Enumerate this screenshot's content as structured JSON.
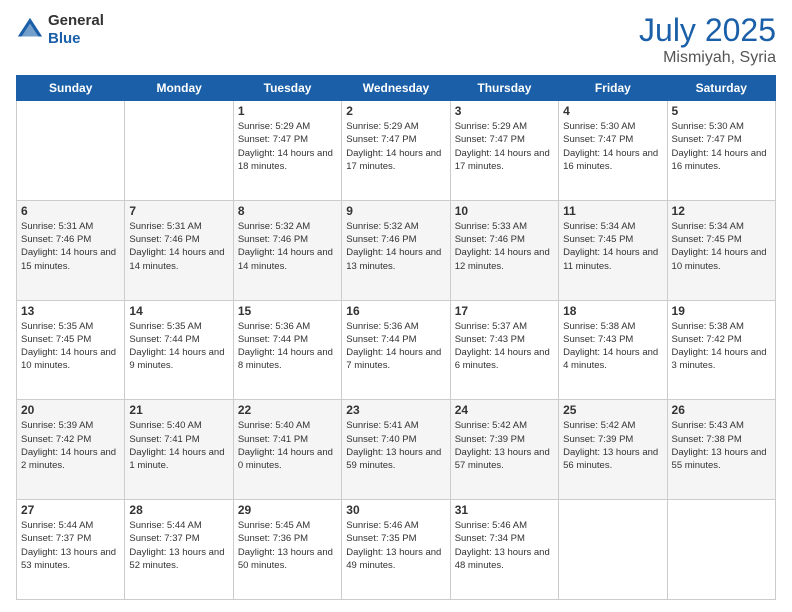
{
  "header": {
    "logo_general": "General",
    "logo_blue": "Blue",
    "title": "July 2025",
    "location": "Mismiyah, Syria"
  },
  "weekdays": [
    "Sunday",
    "Monday",
    "Tuesday",
    "Wednesday",
    "Thursday",
    "Friday",
    "Saturday"
  ],
  "weeks": [
    [
      {
        "day": "",
        "sunrise": "",
        "sunset": "",
        "daylight": ""
      },
      {
        "day": "",
        "sunrise": "",
        "sunset": "",
        "daylight": ""
      },
      {
        "day": "1",
        "sunrise": "Sunrise: 5:29 AM",
        "sunset": "Sunset: 7:47 PM",
        "daylight": "Daylight: 14 hours and 18 minutes."
      },
      {
        "day": "2",
        "sunrise": "Sunrise: 5:29 AM",
        "sunset": "Sunset: 7:47 PM",
        "daylight": "Daylight: 14 hours and 17 minutes."
      },
      {
        "day": "3",
        "sunrise": "Sunrise: 5:29 AM",
        "sunset": "Sunset: 7:47 PM",
        "daylight": "Daylight: 14 hours and 17 minutes."
      },
      {
        "day": "4",
        "sunrise": "Sunrise: 5:30 AM",
        "sunset": "Sunset: 7:47 PM",
        "daylight": "Daylight: 14 hours and 16 minutes."
      },
      {
        "day": "5",
        "sunrise": "Sunrise: 5:30 AM",
        "sunset": "Sunset: 7:47 PM",
        "daylight": "Daylight: 14 hours and 16 minutes."
      }
    ],
    [
      {
        "day": "6",
        "sunrise": "Sunrise: 5:31 AM",
        "sunset": "Sunset: 7:46 PM",
        "daylight": "Daylight: 14 hours and 15 minutes."
      },
      {
        "day": "7",
        "sunrise": "Sunrise: 5:31 AM",
        "sunset": "Sunset: 7:46 PM",
        "daylight": "Daylight: 14 hours and 14 minutes."
      },
      {
        "day": "8",
        "sunrise": "Sunrise: 5:32 AM",
        "sunset": "Sunset: 7:46 PM",
        "daylight": "Daylight: 14 hours and 14 minutes."
      },
      {
        "day": "9",
        "sunrise": "Sunrise: 5:32 AM",
        "sunset": "Sunset: 7:46 PM",
        "daylight": "Daylight: 14 hours and 13 minutes."
      },
      {
        "day": "10",
        "sunrise": "Sunrise: 5:33 AM",
        "sunset": "Sunset: 7:46 PM",
        "daylight": "Daylight: 14 hours and 12 minutes."
      },
      {
        "day": "11",
        "sunrise": "Sunrise: 5:34 AM",
        "sunset": "Sunset: 7:45 PM",
        "daylight": "Daylight: 14 hours and 11 minutes."
      },
      {
        "day": "12",
        "sunrise": "Sunrise: 5:34 AM",
        "sunset": "Sunset: 7:45 PM",
        "daylight": "Daylight: 14 hours and 10 minutes."
      }
    ],
    [
      {
        "day": "13",
        "sunrise": "Sunrise: 5:35 AM",
        "sunset": "Sunset: 7:45 PM",
        "daylight": "Daylight: 14 hours and 10 minutes."
      },
      {
        "day": "14",
        "sunrise": "Sunrise: 5:35 AM",
        "sunset": "Sunset: 7:44 PM",
        "daylight": "Daylight: 14 hours and 9 minutes."
      },
      {
        "day": "15",
        "sunrise": "Sunrise: 5:36 AM",
        "sunset": "Sunset: 7:44 PM",
        "daylight": "Daylight: 14 hours and 8 minutes."
      },
      {
        "day": "16",
        "sunrise": "Sunrise: 5:36 AM",
        "sunset": "Sunset: 7:44 PM",
        "daylight": "Daylight: 14 hours and 7 minutes."
      },
      {
        "day": "17",
        "sunrise": "Sunrise: 5:37 AM",
        "sunset": "Sunset: 7:43 PM",
        "daylight": "Daylight: 14 hours and 6 minutes."
      },
      {
        "day": "18",
        "sunrise": "Sunrise: 5:38 AM",
        "sunset": "Sunset: 7:43 PM",
        "daylight": "Daylight: 14 hours and 4 minutes."
      },
      {
        "day": "19",
        "sunrise": "Sunrise: 5:38 AM",
        "sunset": "Sunset: 7:42 PM",
        "daylight": "Daylight: 14 hours and 3 minutes."
      }
    ],
    [
      {
        "day": "20",
        "sunrise": "Sunrise: 5:39 AM",
        "sunset": "Sunset: 7:42 PM",
        "daylight": "Daylight: 14 hours and 2 minutes."
      },
      {
        "day": "21",
        "sunrise": "Sunrise: 5:40 AM",
        "sunset": "Sunset: 7:41 PM",
        "daylight": "Daylight: 14 hours and 1 minute."
      },
      {
        "day": "22",
        "sunrise": "Sunrise: 5:40 AM",
        "sunset": "Sunset: 7:41 PM",
        "daylight": "Daylight: 14 hours and 0 minutes."
      },
      {
        "day": "23",
        "sunrise": "Sunrise: 5:41 AM",
        "sunset": "Sunset: 7:40 PM",
        "daylight": "Daylight: 13 hours and 59 minutes."
      },
      {
        "day": "24",
        "sunrise": "Sunrise: 5:42 AM",
        "sunset": "Sunset: 7:39 PM",
        "daylight": "Daylight: 13 hours and 57 minutes."
      },
      {
        "day": "25",
        "sunrise": "Sunrise: 5:42 AM",
        "sunset": "Sunset: 7:39 PM",
        "daylight": "Daylight: 13 hours and 56 minutes."
      },
      {
        "day": "26",
        "sunrise": "Sunrise: 5:43 AM",
        "sunset": "Sunset: 7:38 PM",
        "daylight": "Daylight: 13 hours and 55 minutes."
      }
    ],
    [
      {
        "day": "27",
        "sunrise": "Sunrise: 5:44 AM",
        "sunset": "Sunset: 7:37 PM",
        "daylight": "Daylight: 13 hours and 53 minutes."
      },
      {
        "day": "28",
        "sunrise": "Sunrise: 5:44 AM",
        "sunset": "Sunset: 7:37 PM",
        "daylight": "Daylight: 13 hours and 52 minutes."
      },
      {
        "day": "29",
        "sunrise": "Sunrise: 5:45 AM",
        "sunset": "Sunset: 7:36 PM",
        "daylight": "Daylight: 13 hours and 50 minutes."
      },
      {
        "day": "30",
        "sunrise": "Sunrise: 5:46 AM",
        "sunset": "Sunset: 7:35 PM",
        "daylight": "Daylight: 13 hours and 49 minutes."
      },
      {
        "day": "31",
        "sunrise": "Sunrise: 5:46 AM",
        "sunset": "Sunset: 7:34 PM",
        "daylight": "Daylight: 13 hours and 48 minutes."
      },
      {
        "day": "",
        "sunrise": "",
        "sunset": "",
        "daylight": ""
      },
      {
        "day": "",
        "sunrise": "",
        "sunset": "",
        "daylight": ""
      }
    ]
  ]
}
